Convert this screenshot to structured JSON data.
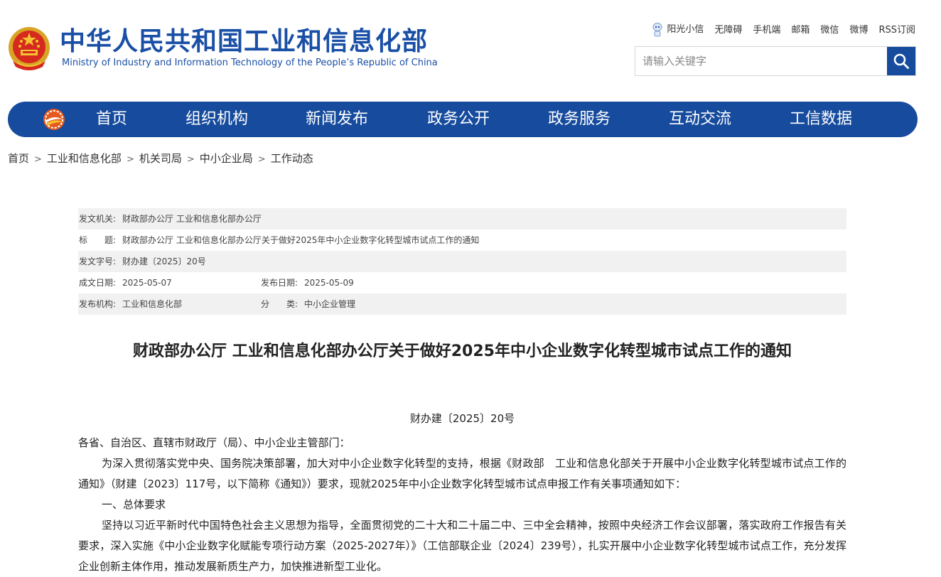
{
  "header": {
    "title_cn": "中华人民共和国工业和信息化部",
    "title_en": "Ministry of Industry and Information Technology of the People’s Republic of China",
    "toplinks": [
      "阳光小信",
      "无障碍",
      "手机端",
      "邮箱",
      "微信",
      "微博",
      "RSS订阅"
    ],
    "search_placeholder": "请输入关键字"
  },
  "nav": {
    "items": [
      "首页",
      "组织机构",
      "新闻发布",
      "政务公开",
      "政务服务",
      "互动交流",
      "工信数据"
    ]
  },
  "breadcrumb": [
    "首页",
    "工业和信息化部",
    "机关司局",
    "中小企业局",
    "工作动态"
  ],
  "breadcrumb_sep": ">",
  "meta": {
    "issuer_label": "发文机关:",
    "issuer": "财政部办公厅 工业和信息化部办公厅",
    "title_label": "标　　题:",
    "title": "财政部办公厅 工业和信息化部办公厅关于做好2025年中小企业数字化转型城市试点工作的通知",
    "docno_label": "发文字号:",
    "docno": "财办建〔2025〕20号",
    "written_label": "成文日期:",
    "written": "2025-05-07",
    "published_label": "发布日期:",
    "published": "2025-05-09",
    "org_label": "发布机构:",
    "org": "工业和信息化部",
    "category_label": "分　　类:",
    "category": "中小企业管理"
  },
  "article": {
    "title": "财政部办公厅 工业和信息化部办公厅关于做好2025年中小企业数字化转型城市试点工作的通知",
    "doc_no": "财办建〔2025〕20号",
    "salutation": "各省、自治区、直辖市财政厅（局）、中小企业主管部门：",
    "p1": "为深入贯彻落实党中央、国务院决策部署，加大对中小企业数字化转型的支持，根据《财政部　工业和信息化部关于开展中小企业数字化转型城市试点工作的通知》（财建〔2023〕117号，以下简称《通知》）要求，现就2025年中小企业数字化转型城市试点申报工作有关事项通知如下：",
    "h1": "一、总体要求",
    "p2": "坚持以习近平新时代中国特色社会主义思想为指导，全面贯彻党的二十大和二十届二中、三中全会精神，按照中央经济工作会议部署，落实政府工作报告有关要求，深入实施《中小企业数字化赋能专项行动方案（2025-2027年）》（工信部联企业〔2024〕239号），扎实开展中小企业数字化转型城市试点工作，充分发挥企业创新主体作用，推动发展新质生产力，加快推进新型工业化。"
  },
  "colors": {
    "brand_blue": "#164b9d",
    "title_blue": "#1a4fa6",
    "meta_shade": "#f1f1f1"
  }
}
